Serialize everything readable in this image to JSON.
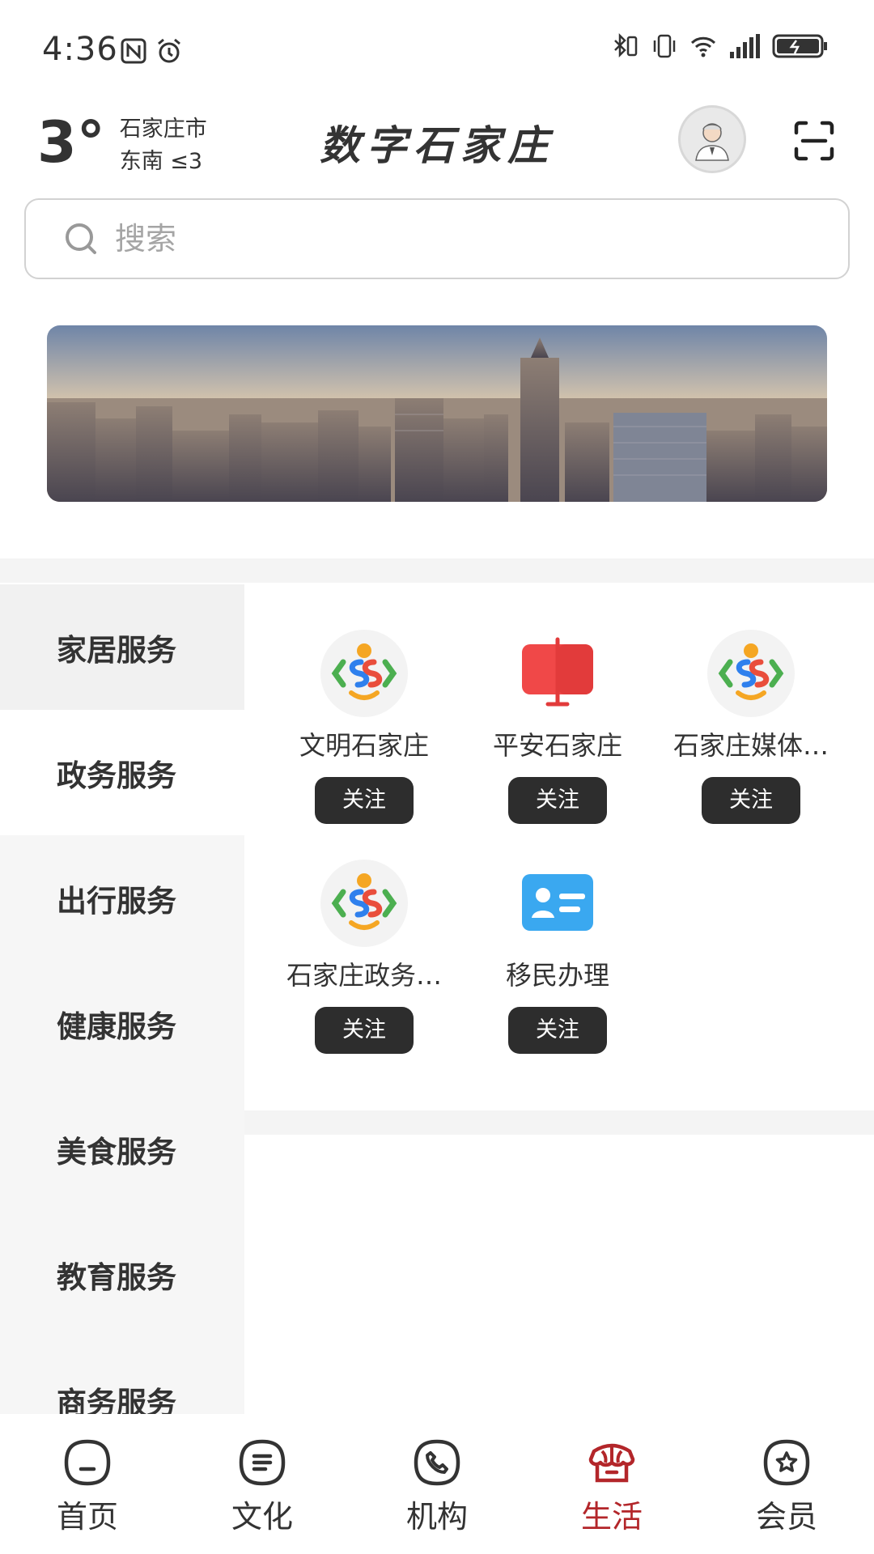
{
  "status_bar": {
    "time": "4:36"
  },
  "header": {
    "temperature": "3°",
    "city": "石家庄市",
    "wind": "东南  ≤3",
    "title": "数字石家庄"
  },
  "search": {
    "placeholder": "搜索"
  },
  "categories": [
    {
      "label": "家居服务"
    },
    {
      "label": "政务服务"
    },
    {
      "label": "出行服务"
    },
    {
      "label": "健康服务"
    },
    {
      "label": "美食服务"
    },
    {
      "label": "教育服务"
    },
    {
      "label": "商务服务"
    }
  ],
  "active_category": "政务服务",
  "services": [
    {
      "name": "文明石家庄",
      "icon": "logo-icon",
      "follow": "关注"
    },
    {
      "name": "平安石家庄",
      "icon": "red-flag-icon",
      "follow": "关注"
    },
    {
      "name": "石家庄媒体…",
      "icon": "logo-icon",
      "follow": "关注"
    },
    {
      "name": "石家庄政务…",
      "icon": "logo-icon",
      "follow": "关注"
    },
    {
      "name": "移民办理",
      "icon": "id-card-icon",
      "follow": "关注"
    }
  ],
  "bottom_nav": [
    {
      "label": "首页",
      "icon": "home-icon"
    },
    {
      "label": "文化",
      "icon": "culture-icon"
    },
    {
      "label": "机构",
      "icon": "phone-icon"
    },
    {
      "label": "生活",
      "icon": "shop-icon"
    },
    {
      "label": "会员",
      "icon": "member-icon"
    }
  ],
  "colors": {
    "accent": "#b3262a",
    "button": "#2d2d2d"
  }
}
